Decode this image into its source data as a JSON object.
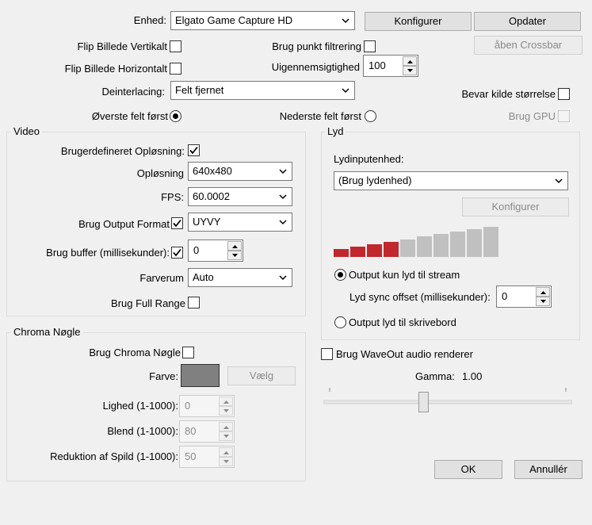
{
  "device": {
    "label": "Enhed:",
    "value": "Elgato Game Capture HD",
    "configure": "Konfigurer",
    "update": "Opdater",
    "open_crossbar": "åben Crossbar"
  },
  "options": {
    "flip_vertical": "Flip Billede Vertikalt",
    "flip_horizontal": "Flip Billede Horizontalt",
    "point_filter": "Brug punkt filtrering",
    "opacity_label": "Uigennemsigtighed",
    "opacity_value": "100",
    "deinterlacing_label": "Deinterlacing:",
    "deinterlacing_value": "Felt fjernet",
    "keep_source_size": "Bevar kilde størrelse",
    "top_field_first": "Øverste felt først",
    "bottom_field_first": "Nederste felt først",
    "use_gpu": "Brug GPU"
  },
  "video": {
    "title": "Video",
    "custom_resolution": "Brugerdefineret Opløsning:",
    "resolution_label": "Opløsning",
    "resolution_value": "640x480",
    "fps_label": "FPS:",
    "fps_value": "60.0002",
    "output_format_label": "Brug Output Format",
    "output_format_value": "UYVY",
    "buffer_label": "Brug buffer (millisekunder):",
    "buffer_value": "0",
    "colorspace_label": "Farverum",
    "colorspace_value": "Auto",
    "full_range": "Brug Full Range"
  },
  "chroma": {
    "title": "Chroma Nøgle",
    "use_chroma": "Brug Chroma Nøgle",
    "color_label": "Farve:",
    "select": "Vælg",
    "similarity_label": "Lighed (1-1000):",
    "similarity_value": "0",
    "blend_label": "Blend (1-1000):",
    "blend_value": "80",
    "spill_label": "Reduktion af Spild (1-1000):",
    "spill_value": "50"
  },
  "audio": {
    "title": "Lyd",
    "input_device_label": "Lydinputenhed:",
    "input_device_value": "(Brug lydenhed)",
    "configure": "Konfigurer",
    "meter_active_bars": 4,
    "meter_total_bars": 10,
    "output_stream": "Output kun lyd til stream",
    "sync_offset_label": "Lyd sync offset (millisekunder):",
    "sync_offset_value": "0",
    "output_desktop": "Output lyd til skrivebord"
  },
  "waveout": "Brug WaveOut audio renderer",
  "gamma": {
    "label": "Gamma:",
    "value": "1.00"
  },
  "buttons": {
    "ok": "OK",
    "cancel": "Annullér"
  },
  "colors": {
    "meter_active": "#c1272d",
    "meter_inactive": "#c0c0c0"
  }
}
